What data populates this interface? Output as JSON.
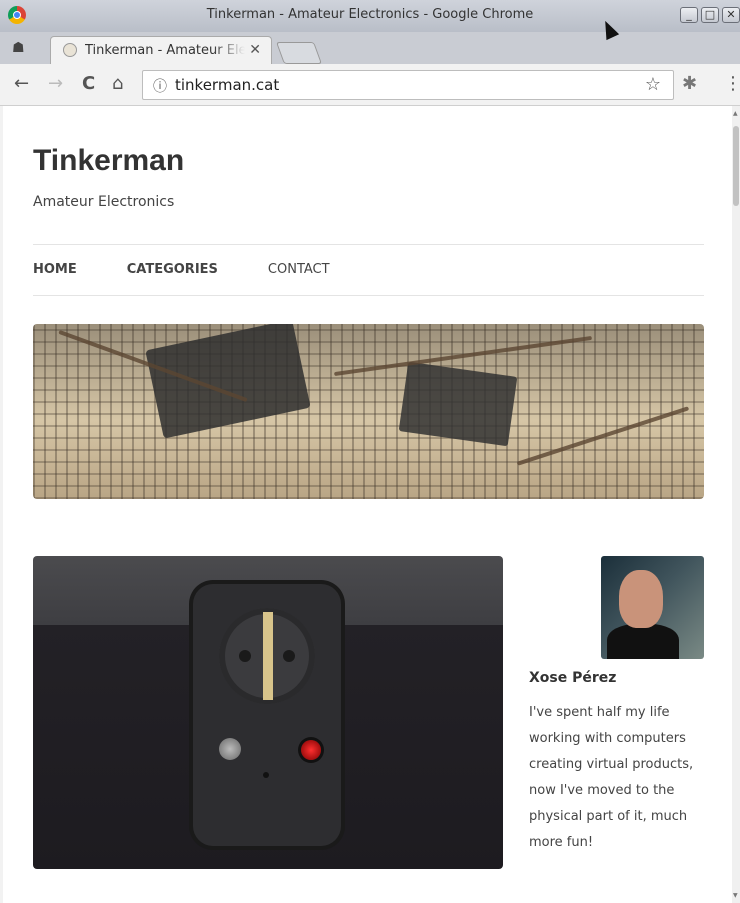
{
  "window": {
    "title": "Tinkerman - Amateur Electronics - Google Chrome",
    "controls": {
      "minimize": "_",
      "maximize": "□",
      "close": "✕"
    }
  },
  "tabs": [
    {
      "title": "Tinkerman - Amateur Electronics",
      "close": "✕"
    }
  ],
  "toolbar": {
    "back": "←",
    "forward": "→",
    "reload": "C",
    "home": "⌂",
    "info_icon": "ⓘ",
    "url": "tinkerman.cat",
    "star": "☆",
    "extension": "✱",
    "menu": "⋮"
  },
  "site": {
    "title": "Tinkerman",
    "description": "Amateur Electronics",
    "nav": [
      {
        "label": "HOME"
      },
      {
        "label": "CATEGORIES"
      },
      {
        "label": "CONTACT"
      }
    ]
  },
  "author": {
    "name": "Xose Pérez",
    "bio": "I've spent half my life working with computers creating virtual products, now I've moved to the physical part of it, much more fun!"
  },
  "colors": {
    "title_text": "#333333",
    "accent_led": "#ff3030"
  }
}
